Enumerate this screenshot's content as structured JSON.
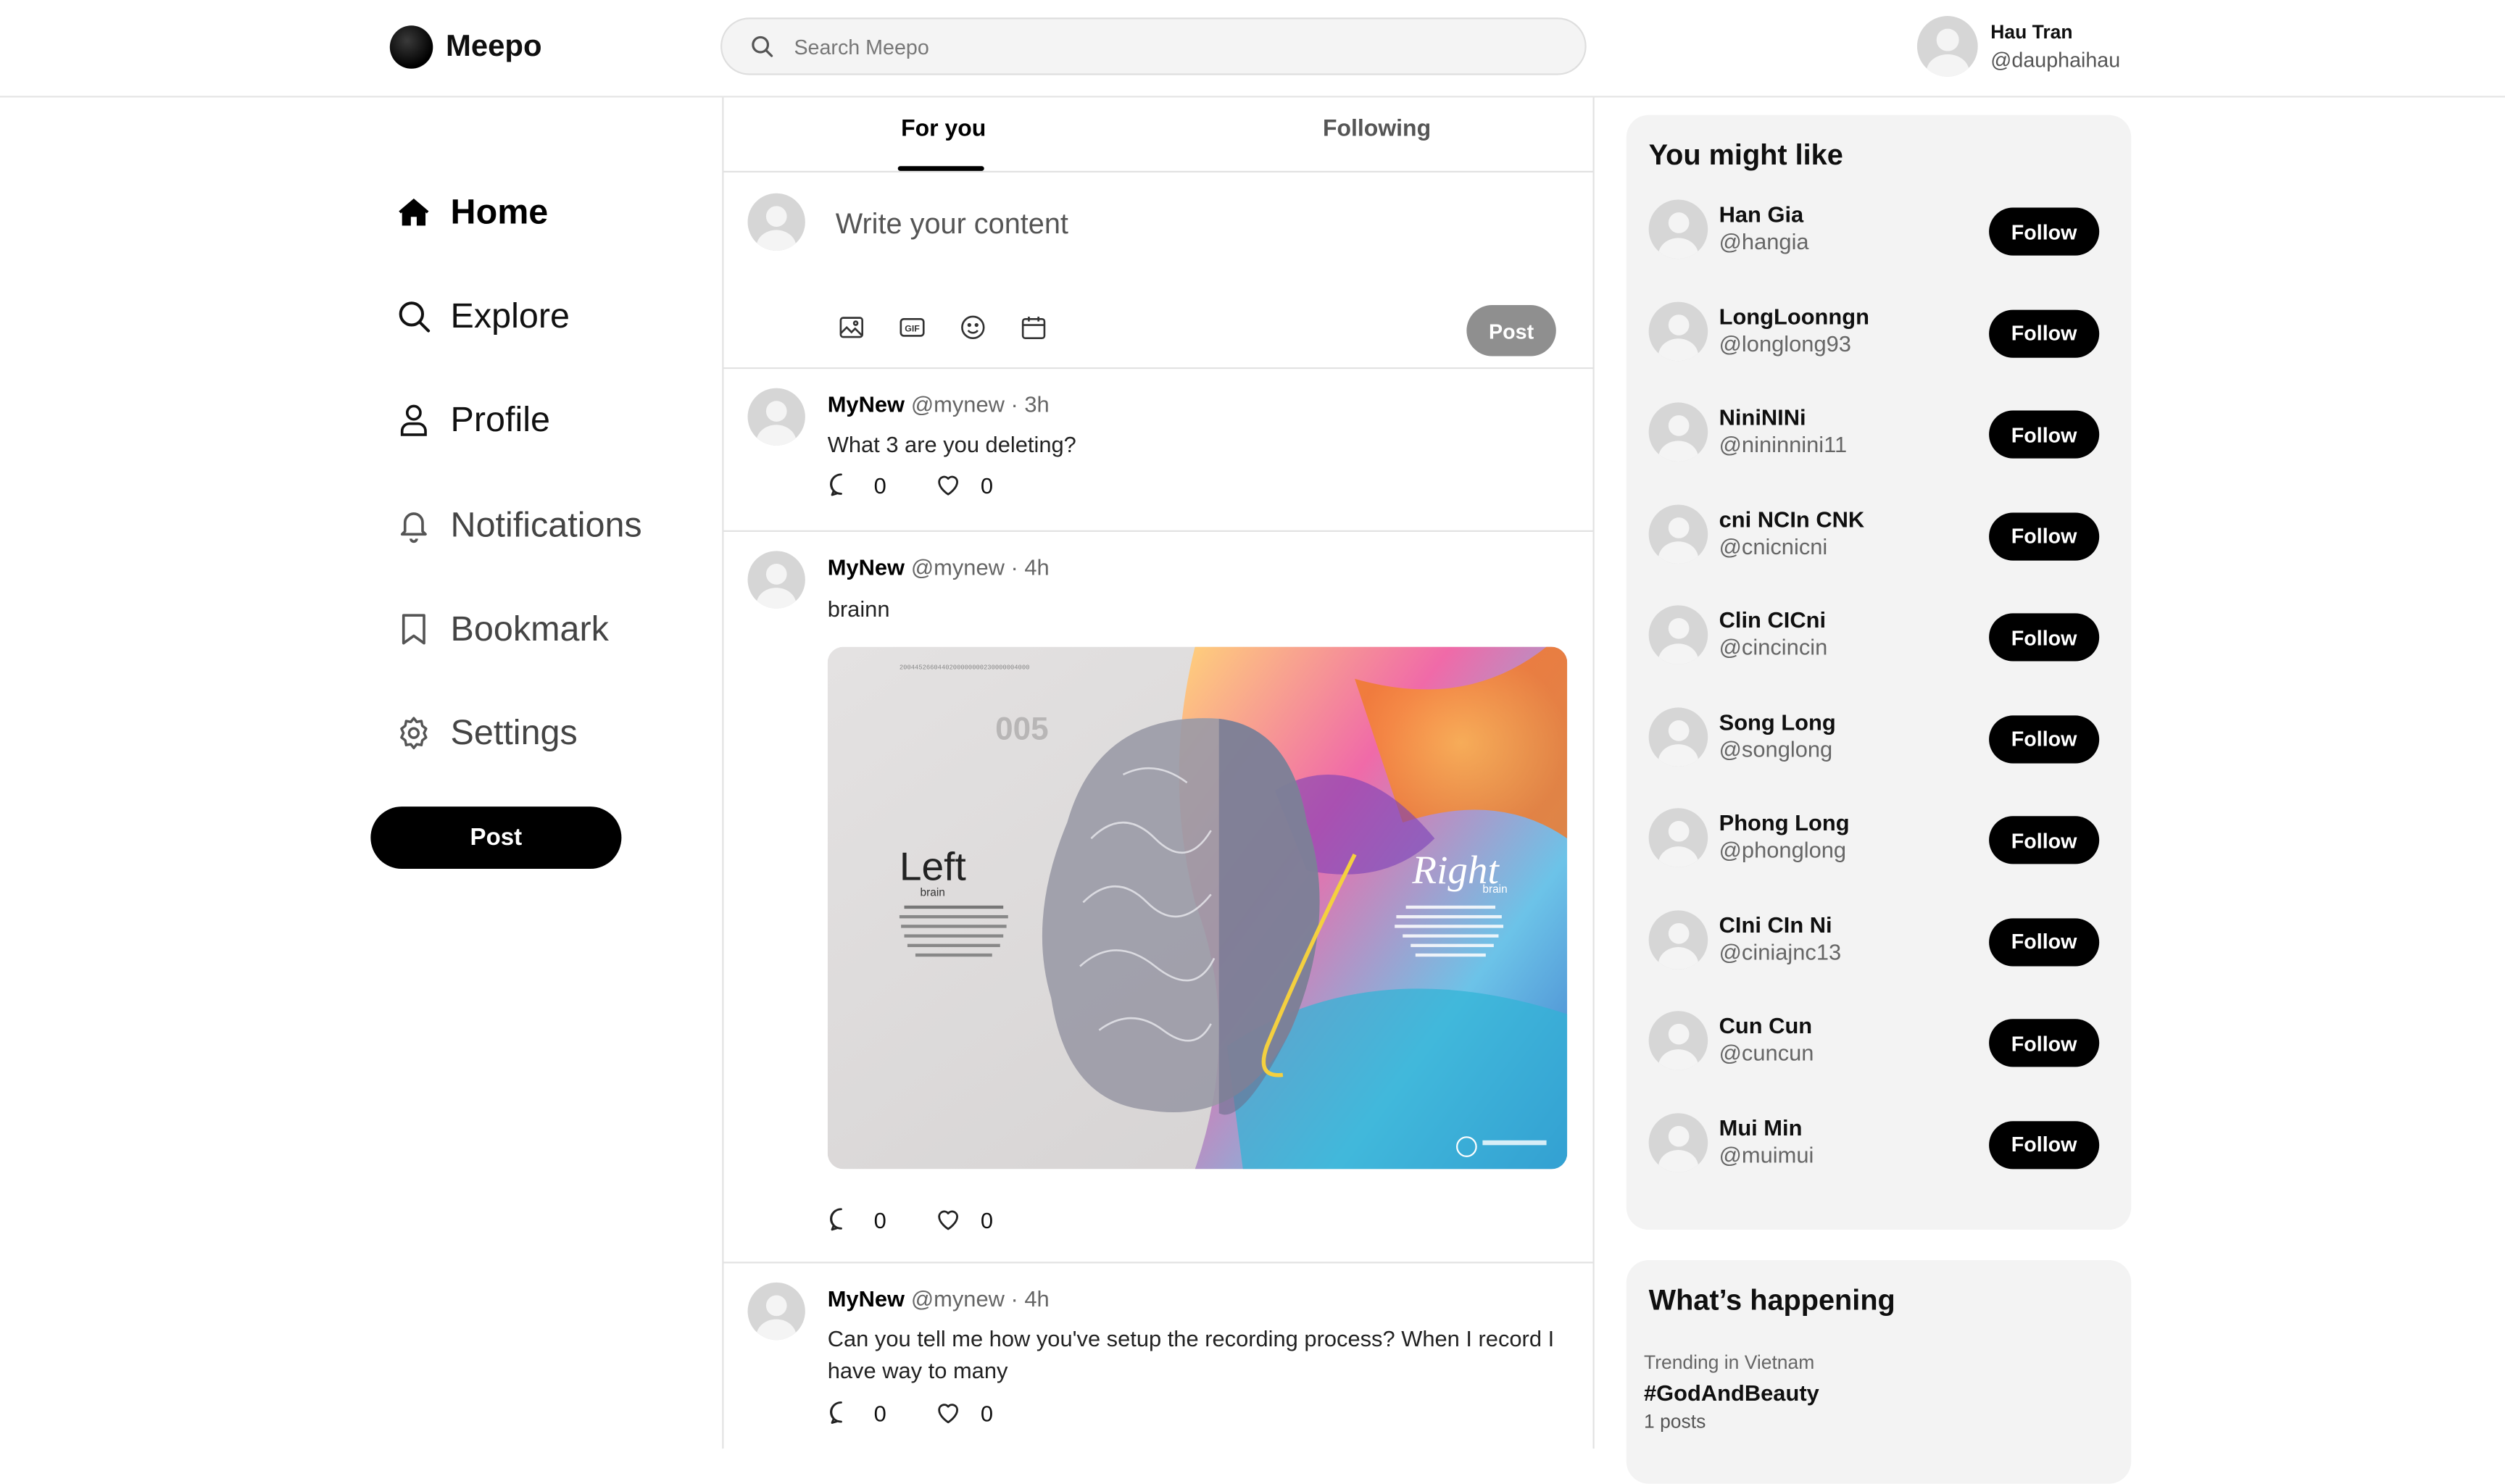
{
  "app": {
    "name": "Meepo"
  },
  "search": {
    "placeholder": "Search Meepo"
  },
  "user": {
    "name": "Hau Tran",
    "handle": "@dauphaihau"
  },
  "nav": {
    "items": [
      {
        "label": "Home",
        "icon": "home-icon",
        "active": true
      },
      {
        "label": "Explore",
        "icon": "search-icon"
      },
      {
        "label": "Profile",
        "icon": "user-icon"
      },
      {
        "label": "Notifications",
        "icon": "bell-icon"
      },
      {
        "label": "Bookmark",
        "icon": "bookmark-icon"
      },
      {
        "label": "Settings",
        "icon": "gear-icon"
      }
    ],
    "post_label": "Post"
  },
  "feed": {
    "tabs": [
      {
        "label": "For you",
        "active": true
      },
      {
        "label": "Following"
      }
    ],
    "composer": {
      "placeholder": "Write your content",
      "post_label": "Post",
      "tools": [
        "image-icon",
        "gif-icon",
        "emoji-icon",
        "calendar-icon"
      ]
    },
    "posts": [
      {
        "name": "MyNew",
        "meta": "@mynew · 3h",
        "text": "What 3 are you deleting?",
        "comments": "0",
        "likes": "0"
      },
      {
        "name": "MyNew",
        "meta": "@mynew · 4h",
        "text": "brainn",
        "comments": "0",
        "likes": "0",
        "image": {
          "left_title": "Left",
          "left_sub": "brain",
          "right_title": "Right",
          "right_sub": "brain",
          "top_num": "005"
        }
      },
      {
        "name": "MyNew",
        "meta": "@mynew · 4h",
        "text": "Can you tell me how you've setup the recording process? When I record I have way to many",
        "comments": "0",
        "likes": "0"
      }
    ]
  },
  "suggestions": {
    "title": "You might like",
    "follow_label": "Follow",
    "users": [
      {
        "name": "Han Gia",
        "handle": "@hangia"
      },
      {
        "name": "LongLoonngn",
        "handle": "@longlong93"
      },
      {
        "name": "NiniNINi",
        "handle": "@nininnini11"
      },
      {
        "name": "cni NCIn CNK",
        "handle": "@cnicnicni"
      },
      {
        "name": "Clin CICni",
        "handle": "@cincincin"
      },
      {
        "name": "Song Long",
        "handle": "@songlong"
      },
      {
        "name": "Phong Long",
        "handle": "@phonglong"
      },
      {
        "name": "CIni CIn Ni",
        "handle": "@ciniajnc13"
      },
      {
        "name": "Cun Cun",
        "handle": "@cuncun"
      },
      {
        "name": "Mui Min",
        "handle": "@muimui"
      }
    ]
  },
  "trends": {
    "title": "What’s happening",
    "items": [
      {
        "context": "Trending in Vietnam",
        "tag": "#GodAndBeauty",
        "count": "1 posts"
      }
    ]
  }
}
